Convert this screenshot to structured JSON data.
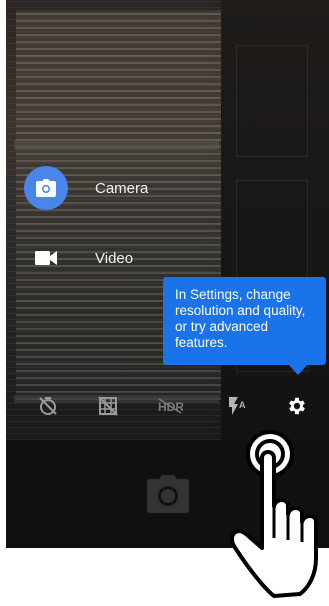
{
  "modes": [
    {
      "label": "Camera",
      "icon": "camera-icon",
      "active": true
    },
    {
      "label": "Video",
      "icon": "video-camera-icon",
      "active": false
    }
  ],
  "tooltip": {
    "text": "In Settings, change resolution and quality, or try advanced features."
  },
  "settings_bar": {
    "icons": [
      "timer-off-icon",
      "grid-off-icon",
      "hdr-off-icon",
      "flash-auto-icon",
      "gear-icon"
    ]
  },
  "bottom_bar": {
    "shutter_icon": "camera-shutter-icon"
  },
  "colors": {
    "accent": "#1a73e8",
    "mode_active": "#4a86e8"
  }
}
